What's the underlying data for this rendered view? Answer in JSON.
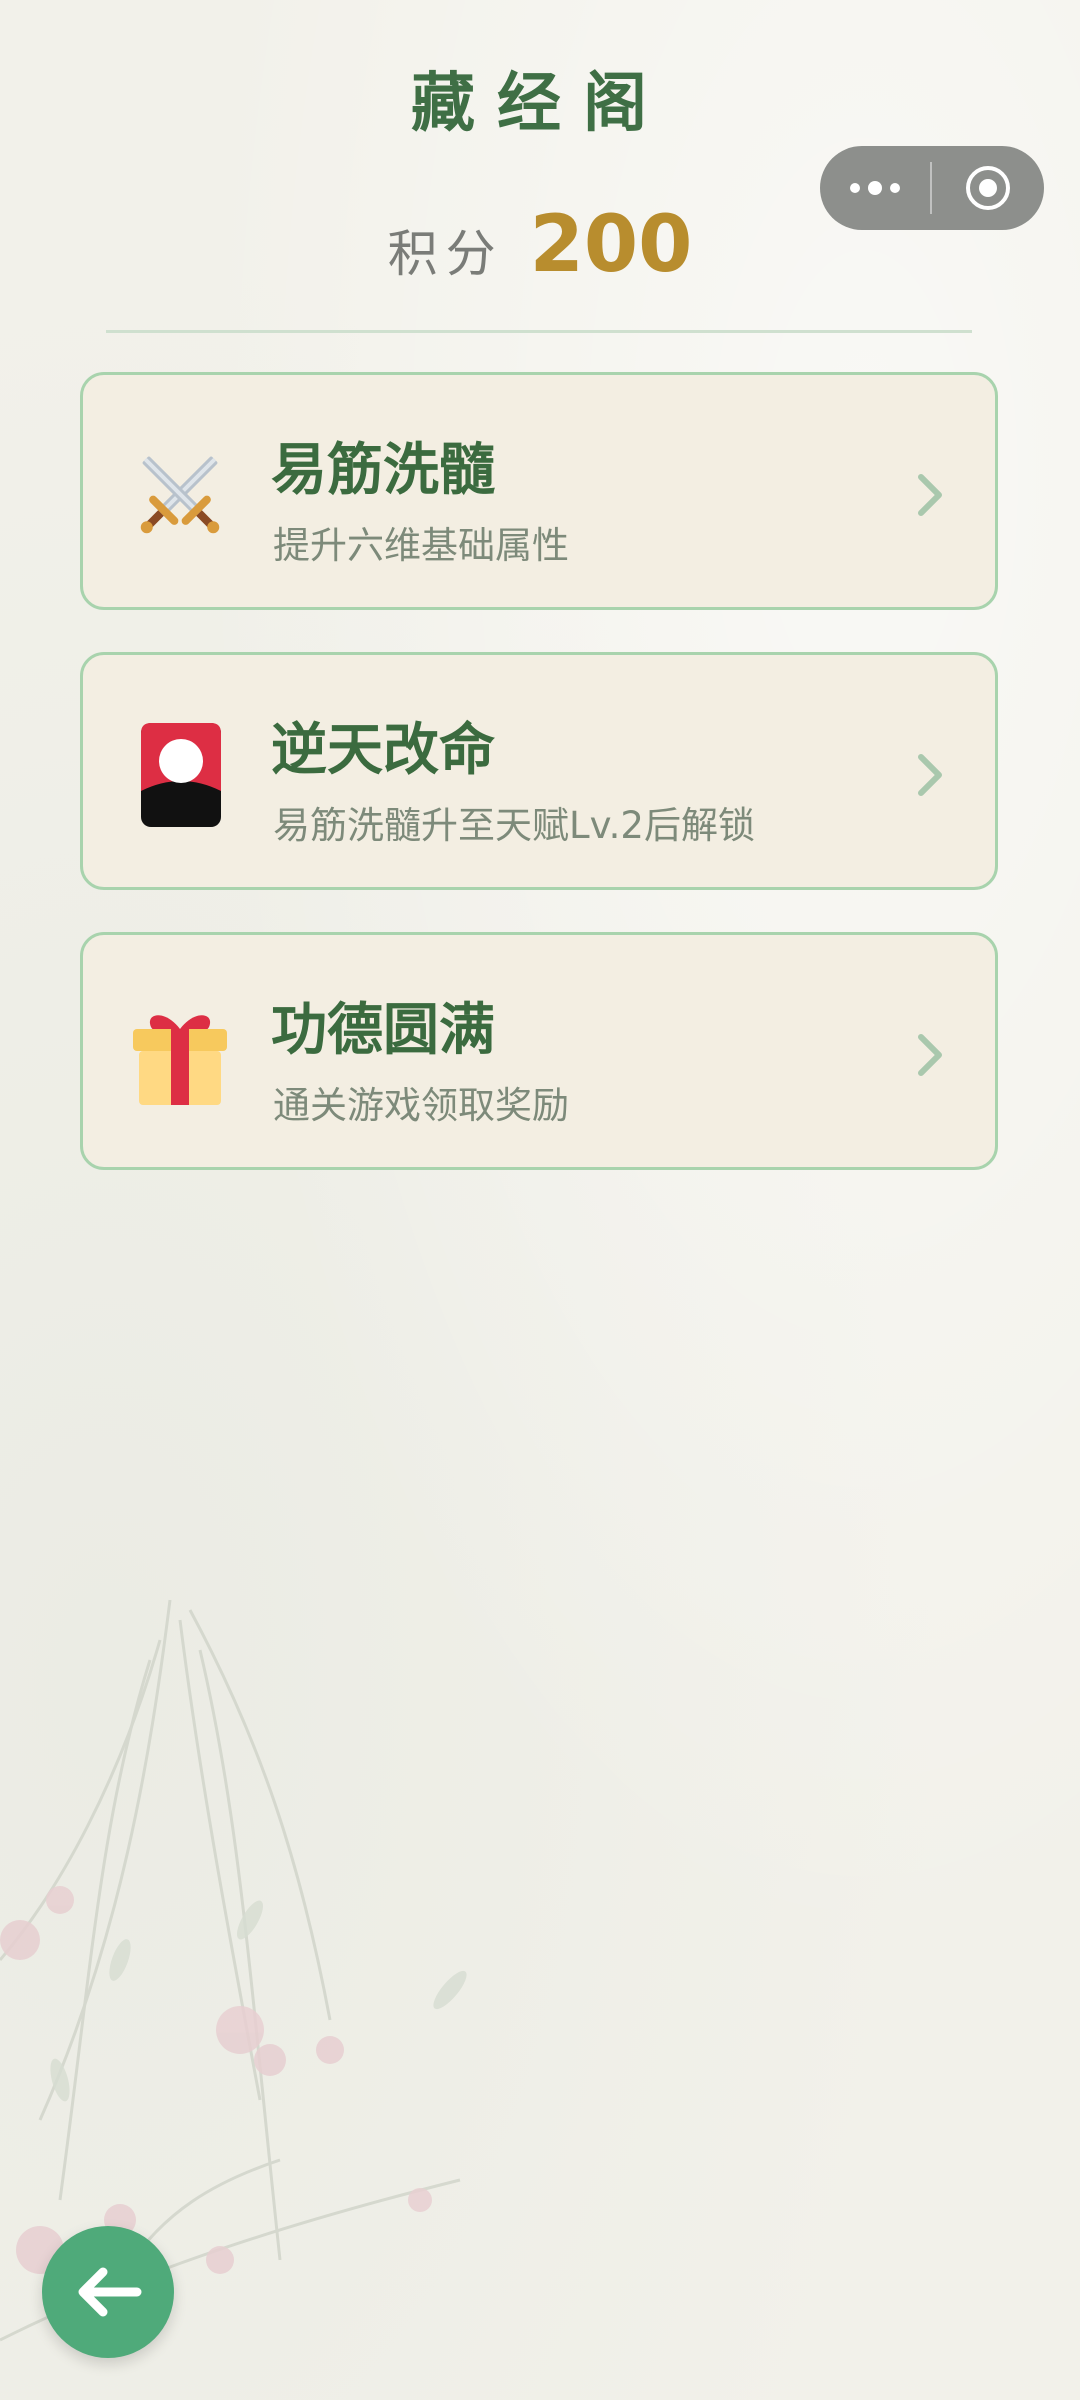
{
  "page": {
    "title": "藏经阁"
  },
  "score": {
    "label": "积分",
    "value": "200"
  },
  "menu": [
    {
      "title": "易筋洗髓",
      "subtitle": "提升六维基础属性",
      "icon": "crossed-swords-icon"
    },
    {
      "title": "逆天改命",
      "subtitle": "易筋洗髓升至天赋Lv.2后解锁",
      "icon": "fate-card-icon"
    },
    {
      "title": "功德圆满",
      "subtitle": "通关游戏领取奖励",
      "icon": "gift-icon"
    }
  ],
  "colors": {
    "title_green": "#3f6f45",
    "score_gold": "#b88d2e",
    "card_border": "#a8d3ad",
    "card_bg": "#f3eee2",
    "back_button": "#4faa7a"
  }
}
